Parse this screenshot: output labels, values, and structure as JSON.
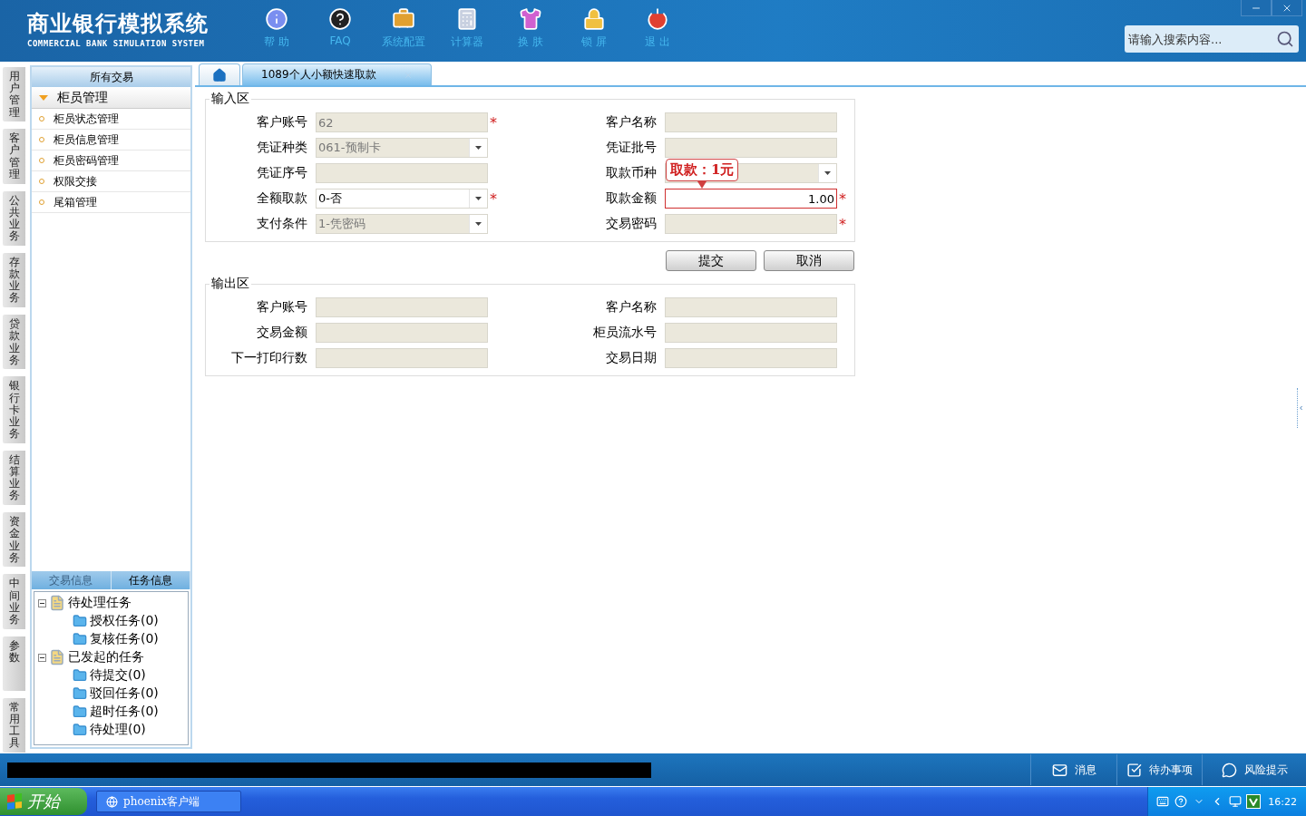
{
  "header": {
    "title": "商业银行模拟系统",
    "subtitle": "COMMERCIAL BANK SIMULATION SYSTEM",
    "nav": [
      {
        "kind": "help",
        "label": "帮 助"
      },
      {
        "kind": "faq",
        "label": "FAQ"
      },
      {
        "kind": "config",
        "label": "系统配置"
      },
      {
        "kind": "calculator",
        "label": "计算器"
      },
      {
        "kind": "skin",
        "label": "换 肤"
      },
      {
        "kind": "lock",
        "label": "锁 屏"
      },
      {
        "kind": "exit",
        "label": "退 出"
      }
    ],
    "search": {
      "placeholder": "请输入搜索内容..."
    }
  },
  "side_tabs": [
    "用户管理",
    "客户管理",
    "公共业务",
    "存款业务",
    "贷款业务",
    "银行卡业务",
    "结算业务",
    "资金业务",
    "中间业务",
    "参数",
    "常用工具"
  ],
  "sidebar": {
    "title": "所有交易",
    "group": {
      "label": "柜员管理",
      "expanded": true,
      "items": [
        "柜员状态管理",
        "柜员信息管理",
        "柜员密码管理",
        "权限交接",
        "尾箱管理"
      ]
    },
    "info_tabs": [
      {
        "label": "交易信息",
        "selected": false
      },
      {
        "label": "任务信息",
        "selected": true
      }
    ],
    "tree": [
      {
        "label": "待处理任务",
        "expanded": true,
        "children": [
          {
            "label": "授权任务(0)"
          },
          {
            "label": "复核任务(0)"
          }
        ]
      },
      {
        "label": "已发起的任务",
        "expanded": true,
        "children": [
          {
            "label": "待提交(0)"
          },
          {
            "label": "驳回任务(0)"
          },
          {
            "label": "超时任务(0)"
          },
          {
            "label": "待处理(0)"
          }
        ]
      }
    ]
  },
  "tabs": [
    {
      "kind": "home",
      "selected": false
    },
    {
      "kind": "page",
      "label": "1089个人小额快速取款",
      "selected": true
    }
  ],
  "input_section": {
    "title": "输入区",
    "fields": [
      {
        "label": "客户账号",
        "kind": "text",
        "value": "62",
        "editable": false,
        "required": true
      },
      {
        "label": "客户名称",
        "kind": "text",
        "editable": false,
        "required": false
      },
      {
        "label": "凭证种类",
        "kind": "select",
        "value": "061-预制卡",
        "editable": false,
        "required": false
      },
      {
        "label": "凭证批号",
        "kind": "text",
        "editable": false,
        "required": false
      },
      {
        "label": "凭证序号",
        "kind": "text",
        "editable": false,
        "required": false
      },
      {
        "label": "取款币种",
        "kind": "select",
        "editable": false,
        "required": false
      },
      {
        "label": "全额取款",
        "kind": "select",
        "value": "0-否",
        "editable": true,
        "required": true
      },
      {
        "label": "取款金额",
        "kind": "amount",
        "value": "1.00",
        "editable": true,
        "required": true,
        "focused": true
      },
      {
        "label": "支付条件",
        "kind": "select",
        "value": "1-凭密码",
        "editable": false,
        "required": false
      },
      {
        "label": "交易密码",
        "kind": "text",
        "editable": false,
        "required": true
      }
    ],
    "tooltip": "取款：1元",
    "required_mark": "*"
  },
  "buttons": [
    "提交",
    "取消"
  ],
  "output_section": {
    "title": "输出区",
    "fields": [
      {
        "label": "客户账号"
      },
      {
        "label": "客户名称"
      },
      {
        "label": "交易金额"
      },
      {
        "label": "柜员流水号"
      },
      {
        "label": "下一打印行数"
      },
      {
        "label": "交易日期"
      }
    ]
  },
  "status_bar": {
    "items": [
      {
        "kind": "message",
        "label": "消息"
      },
      {
        "kind": "todo",
        "label": "待办事项"
      },
      {
        "kind": "risk",
        "label": "风险提示"
      }
    ]
  },
  "taskbar": {
    "start": "开始",
    "task": "phoenix客户端",
    "clock": "16:22"
  }
}
